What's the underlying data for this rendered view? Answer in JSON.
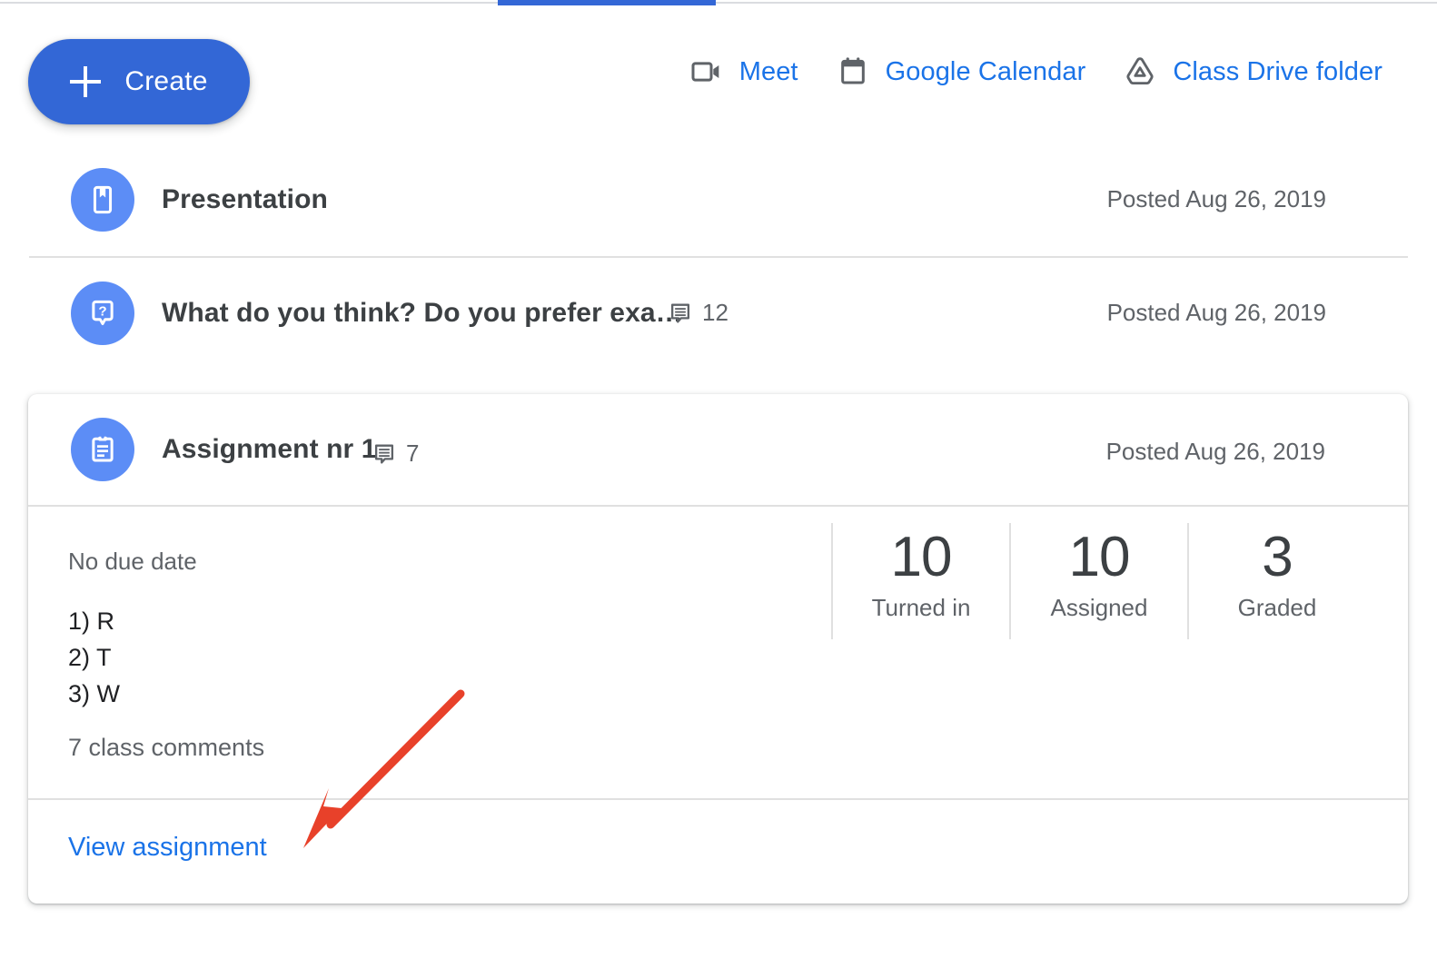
{
  "tabstrip": {
    "active_tab_indicator": true
  },
  "header": {
    "create_button": {
      "label": "Create",
      "icon": "plus-icon",
      "color": "#3367d6"
    },
    "links": [
      {
        "label": "Meet",
        "icon": "meet-camera-icon",
        "color": "#1a73e8"
      },
      {
        "label": "Google Calendar",
        "icon": "calendar-icon",
        "color": "#1a73e8"
      },
      {
        "label": "Class Drive folder",
        "icon": "drive-folder-icon",
        "color": "#1a73e8"
      }
    ]
  },
  "stream": {
    "rows": [
      {
        "icon": "material-book-icon",
        "title": "Presentation",
        "comment_count": null,
        "date": "Posted Aug 26, 2019"
      },
      {
        "icon": "question-bubble-icon",
        "title": "What do you think? Do you prefer exa…",
        "comment_count": "12",
        "date": "Posted Aug 26, 2019"
      }
    ]
  },
  "assignment_card": {
    "icon": "assignment-clipboard-icon",
    "title": "Assignment nr 1",
    "comment_count": "7",
    "date": "Posted Aug 26, 2019",
    "due_text": "No due date",
    "description_lines": [
      "1) R",
      "2) T",
      "3) W"
    ],
    "class_comments": "7 class comments",
    "stats": [
      {
        "number": "10",
        "label": "Turned in"
      },
      {
        "number": "10",
        "label": "Assigned"
      },
      {
        "number": "3",
        "label": "Graded"
      }
    ],
    "view_link": "View assignment"
  },
  "annotation": {
    "arrow_color": "#e8412a",
    "points_to": "View assignment"
  }
}
